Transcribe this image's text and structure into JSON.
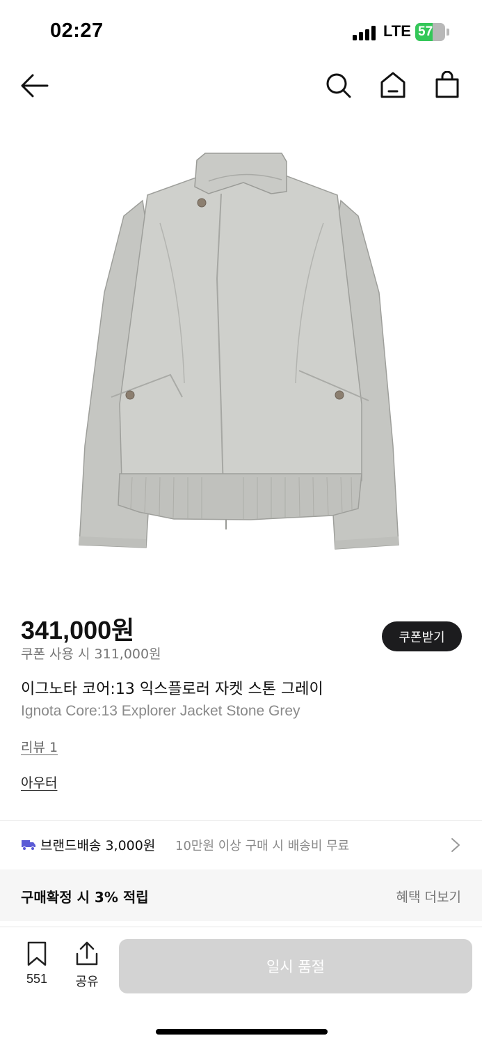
{
  "status_bar": {
    "time": "02:27",
    "network": "LTE",
    "battery_level": "57",
    "battery_fraction": 0.57
  },
  "nav": {
    "back_icon": "arrow-left-icon",
    "search_icon": "search-icon",
    "home_icon": "home-icon",
    "cart_icon": "shopping-bag-icon"
  },
  "product": {
    "image_alt": "stone grey jacket",
    "price": "341,000원",
    "coupon_price": "쿠폰 사용 시 311,000원",
    "coupon_button": "쿠폰받기",
    "name_ko": "이그노타 코어:13 익스플로러 자켓 스톤 그레이",
    "name_en": "Ignota Core:13 Explorer Jacket Stone Grey",
    "review_link": "리뷰 1",
    "category_link": "아우터"
  },
  "shipping": {
    "label": "브랜드배송 3,000원",
    "note": "10만원 이상 구매 시 배송비 무료",
    "icon": "truck-icon",
    "accent": "#5b5bd6"
  },
  "benefit": {
    "title": "구매확정 시 3% 적립",
    "more": "혜택 더보기"
  },
  "bottom_bar": {
    "bookmark_count": "551",
    "share_label": "공유",
    "soldout_label": "일시 품절"
  }
}
